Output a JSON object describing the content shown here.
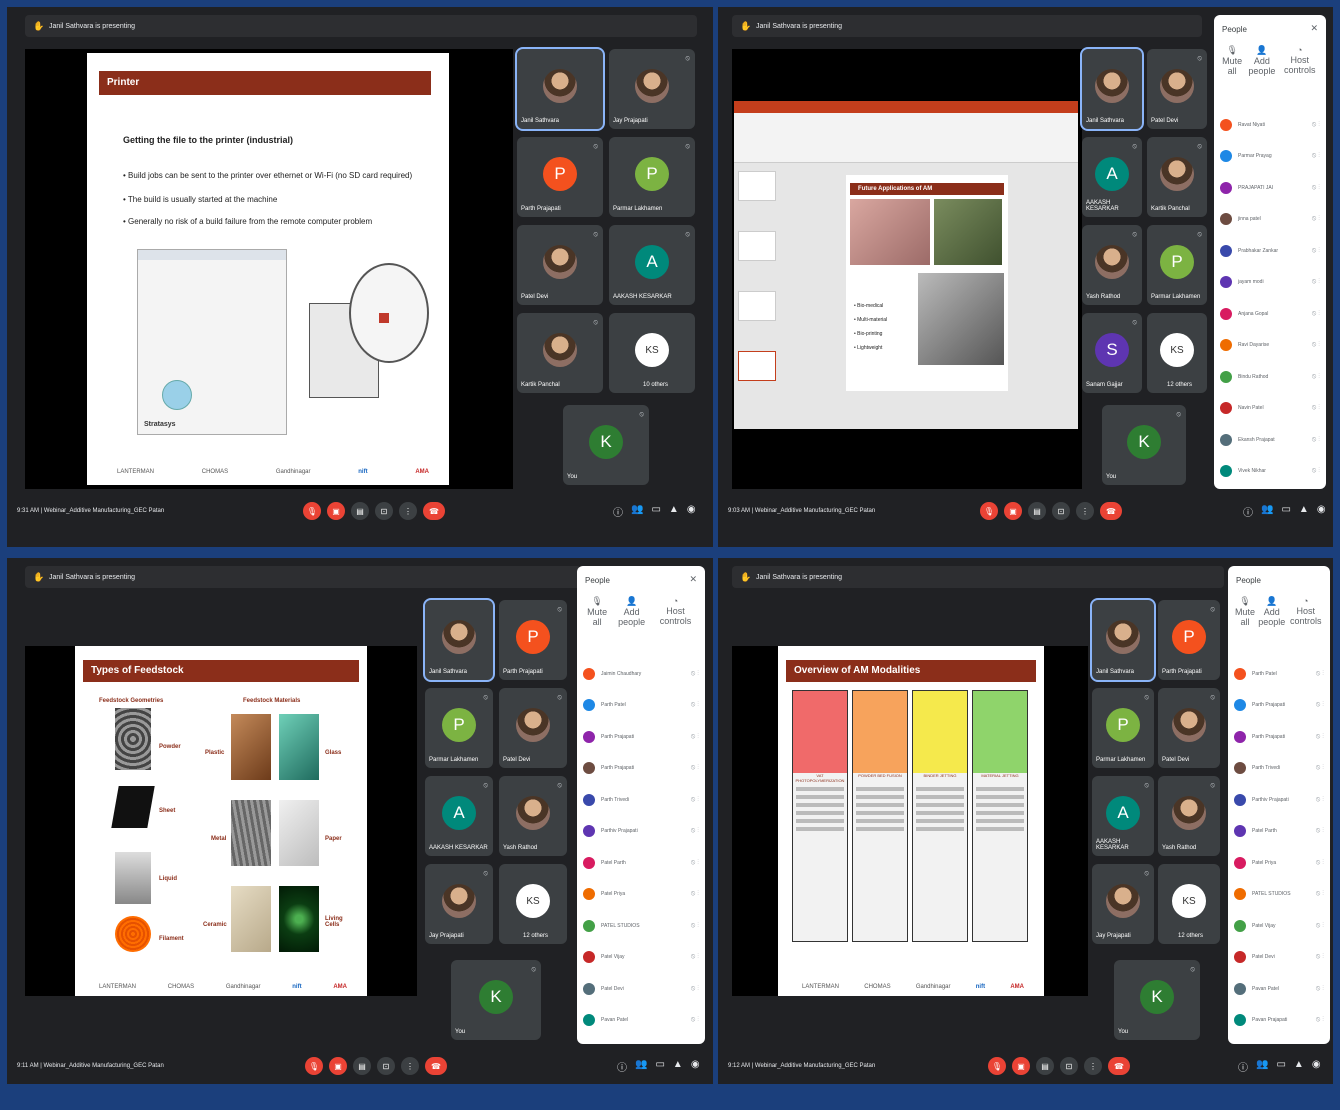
{
  "meeting": {
    "presenter": "Janil Sathvara is presenting",
    "title": "Webinar_Additive Manufacturing_GEC Patan",
    "you_label": "You"
  },
  "times": [
    "9:31 AM",
    "9:03 AM",
    "9:11 AM",
    "9:12 AM"
  ],
  "people_panel": {
    "title": "People",
    "mute_all": "Mute all",
    "add_people": "Add people",
    "host_controls": "Host controls"
  },
  "q1": {
    "slide_title": "Printer",
    "subtitle": "Getting the file to the printer (industrial)",
    "bullets": [
      "Build jobs can be sent to the printer over ethernet or Wi-Fi (no SD card required)",
      "The build is usually started at the machine",
      "Generally no risk of a build failure from the remote computer problem"
    ],
    "brand": "Stratasys",
    "logos": [
      "LANTERMAN",
      "CHOMAS",
      "Gandhinagar",
      "nift",
      "AMA"
    ],
    "tiles": [
      {
        "name": "Janil Sathvara"
      },
      {
        "name": "Jay Prajapati"
      },
      {
        "name": "Parth Prajapati",
        "initial": "P"
      },
      {
        "name": "Parmar Lakhamen",
        "initial": "P"
      },
      {
        "name": "Patel Devi"
      },
      {
        "name": "AAKASH KESARKAR",
        "initial": "A"
      },
      {
        "name": "Kartik Panchal"
      },
      {
        "name": "10 others",
        "initials": "KS"
      },
      {
        "name": "You",
        "initial": "K"
      }
    ]
  },
  "q2": {
    "slide_title": "Future Applications of AM",
    "bullets": [
      "Bio-medical",
      "Multi-material",
      "Bio-printing",
      "Lightweight"
    ],
    "tiles": [
      {
        "name": "Janil Sathvara"
      },
      {
        "name": "Patel Devi"
      },
      {
        "name": "AAKASH KESARKAR",
        "initial": "A"
      },
      {
        "name": "Kartik Panchal"
      },
      {
        "name": "Yash Rathod"
      },
      {
        "name": "Parmar Lakhamen",
        "initial": "P"
      },
      {
        "name": "Sanam Gajjar",
        "initial": "S"
      },
      {
        "name": "12 others",
        "initials": "KS"
      },
      {
        "name": "You",
        "initial": "K"
      }
    ],
    "people": [
      "Ravat Niyati",
      "Parmar Prayag",
      "PRAJAPATI JAI",
      "jinna patel",
      "Prabhakar Zankar",
      "jayam modi",
      "Anjana Gopal",
      "Ravi Dayarise",
      "Bindu Rathod",
      "Navin Patel",
      "Ekansh Prajapat",
      "Vivek Nikhar"
    ]
  },
  "q3": {
    "slide_title": "Types of Feedstock",
    "col1": "Feedstock Geometries",
    "col2": "Feedstock Materials",
    "geometries": [
      "Powder",
      "Sheet",
      "Liquid",
      "Filament"
    ],
    "materials": [
      "Plastic",
      "Glass",
      "Metal",
      "Paper",
      "Ceramic",
      "Living Cells"
    ],
    "tiles": [
      {
        "name": "Janil Sathvara"
      },
      {
        "name": "Parth Prajapati",
        "initial": "P"
      },
      {
        "name": "Parmar Lakhamen",
        "initial": "P"
      },
      {
        "name": "Patel Devi"
      },
      {
        "name": "AAKASH KESARKAR",
        "initial": "A"
      },
      {
        "name": "Yash Rathod"
      },
      {
        "name": "Jay Prajapati"
      },
      {
        "name": "12 others",
        "initials": "KS"
      },
      {
        "name": "You",
        "initial": "K"
      }
    ],
    "people": [
      "Jaimin Chaudhary",
      "Parth Patel",
      "Parth Prajapati",
      "Parth Prajapati",
      "Parth Trivedi",
      "Parthiv Prajapati",
      "Patel Parth",
      "Patel Priya",
      "PATEL STUDIOS",
      "Patel Vijay",
      "Patel Devi",
      "Pavan Patel"
    ]
  },
  "q4": {
    "slide_title": "Overview of AM Modalities",
    "modalities": [
      "VAT PHOTOPOLYMERIZATION",
      "POWDER BED FUSION",
      "BINDER JETTING",
      "MATERIAL JETTING"
    ],
    "tiles": [
      {
        "name": "Janil Sathvara"
      },
      {
        "name": "Parth Prajapati",
        "initial": "P"
      },
      {
        "name": "Parmar Lakhamen",
        "initial": "P"
      },
      {
        "name": "Patel Devi"
      },
      {
        "name": "AAKASH KESARKAR",
        "initial": "A"
      },
      {
        "name": "Yash Rathod"
      },
      {
        "name": "Jay Prajapati"
      },
      {
        "name": "12 others",
        "initials": "KS"
      },
      {
        "name": "You",
        "initial": "K"
      }
    ],
    "people": [
      "Parth Patel",
      "Parth Prajapati",
      "Parth Prajapati",
      "Parth Trivedi",
      "Parthiv Prajapati",
      "Patel Parth",
      "Patel Priya",
      "PATEL STUDIOS",
      "Patel Vijay",
      "Patel Devi",
      "Pavan Patel",
      "Pavan Prajapati"
    ]
  },
  "colors": {
    "header": "#8b2e1a",
    "meet_bg": "#202124",
    "tile": "#3c4043",
    "red": "#ea4335",
    "blue": "#8ab4f8"
  }
}
